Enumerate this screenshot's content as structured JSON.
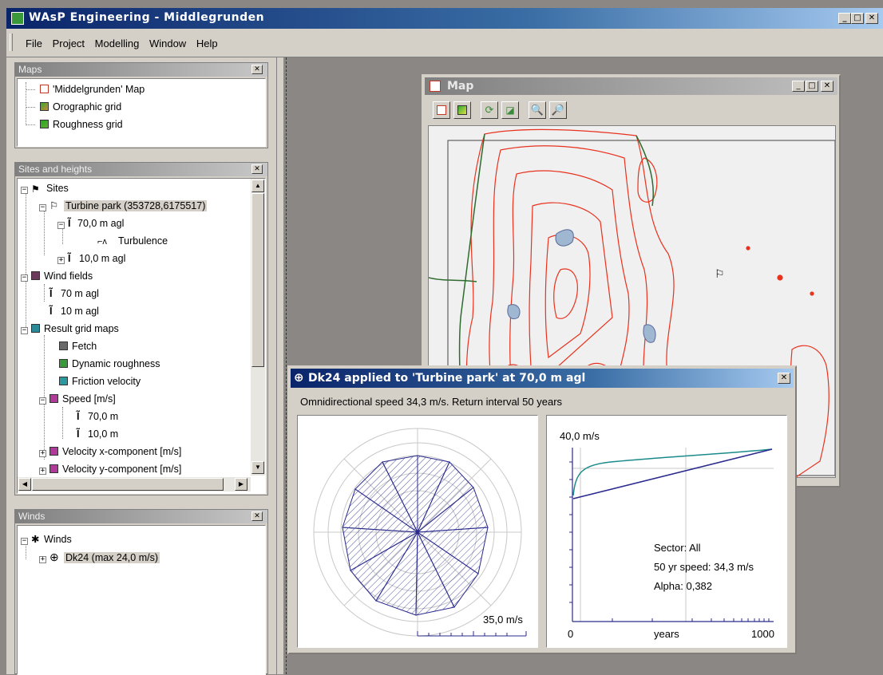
{
  "app": {
    "title": "WAsP Engineering - Middlegrunden",
    "menu": [
      "File",
      "Project",
      "Modelling",
      "Window",
      "Help"
    ]
  },
  "maps_panel": {
    "title": "Maps",
    "items": [
      "'Middelgrunden' Map",
      "Orographic grid",
      "Roughness grid"
    ]
  },
  "sites_panel": {
    "title": "Sites and heights",
    "items": [
      "Sites",
      "Turbine park (353728,6175517)",
      "70,0 m agl",
      "Turbulence",
      "10,0 m agl",
      "Wind fields",
      "70 m agl",
      "10 m agl",
      "Result grid maps",
      "Fetch",
      "Dynamic roughness",
      "Friction velocity",
      "Speed [m/s]",
      "70,0 m",
      "10,0 m",
      "Velocity x-component [m/s]",
      "Velocity y-component [m/s]"
    ]
  },
  "winds_panel": {
    "title": "Winds",
    "items": [
      "Winds",
      "Dk24 (max 24,0 m/s)"
    ]
  },
  "map_window": {
    "title": "Map"
  },
  "dk_window": {
    "title": "Dk24 applied to 'Turbine park' at 70,0 m agl",
    "subtitle": "Omnidirectional speed 34,3 m/s. Return interval 50 years",
    "rose_scale_label": "35,0 m/s",
    "plot": {
      "y_label": "40,0 m/s",
      "x_start": "0",
      "x_label": "years",
      "x_end": "1000",
      "info": [
        "Sector: All",
        "50 yr speed: 34,3 m/s",
        "Alpha: 0,382"
      ]
    }
  },
  "colors": {
    "active_title": "#0a246a",
    "contour": "#e8321e",
    "coast": "#2e6b2e",
    "rose": "#2a2a8c",
    "curve_teal": "#1a8a8a"
  }
}
